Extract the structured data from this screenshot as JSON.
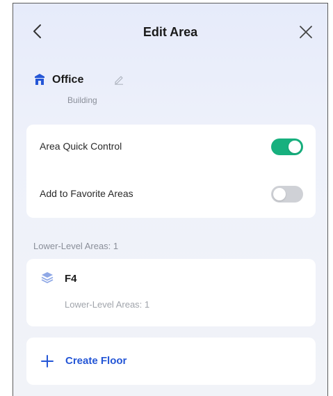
{
  "header": {
    "title": "Edit Area",
    "back_icon": "chevron-left-icon",
    "close_icon": "close-icon"
  },
  "area": {
    "name": "Office",
    "type": "Building",
    "icon": "building-icon",
    "edit_icon": "pencil-icon",
    "icon_color": "#2456d6"
  },
  "settings": [
    {
      "label": "Area Quick Control",
      "state": "on"
    },
    {
      "label": "Add to Favorite Areas",
      "state": "off"
    }
  ],
  "lower_level": {
    "section_label": "Lower-Level Areas: 1",
    "items": [
      {
        "name": "F4",
        "subtitle": "Lower-Level Areas: 1",
        "icon": "layers-icon"
      }
    ]
  },
  "create_floor": {
    "label": "Create Floor",
    "icon": "plus-icon"
  },
  "colors": {
    "accent": "#2456d6",
    "toggle_on": "#17b07e",
    "toggle_off": "#cfd1d6"
  }
}
